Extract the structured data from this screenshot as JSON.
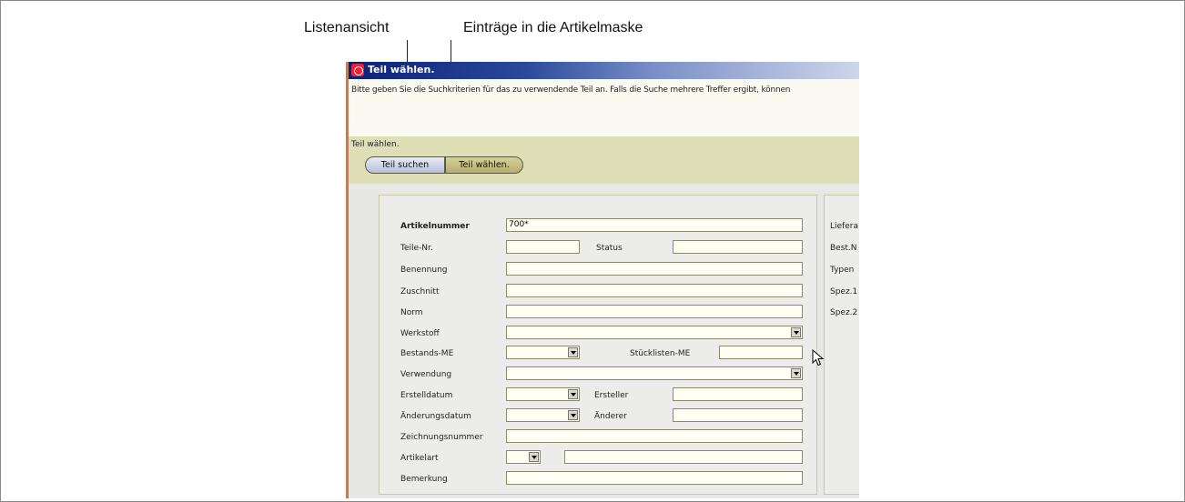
{
  "callouts": {
    "list_view": "Listenansicht",
    "entries": "Einträge in die Artikelmaske"
  },
  "window": {
    "title": "Teil wählen.",
    "description": "Bitte geben Sie die Suchkriterien für das zu verwendende Teil an. Falls die Suche mehrere Treffer ergibt, können",
    "section_label": "Teil wählen.",
    "buttons": {
      "search": "Teil suchen",
      "select": "Teil wählen."
    }
  },
  "form": {
    "artikelnummer_label": "Artikelnummer",
    "artikelnummer_value": "700*",
    "teilenr_label": "Teile-Nr.",
    "status_label": "Status",
    "benennung_label": "Benennung",
    "zuschnitt_label": "Zuschnitt",
    "norm_label": "Norm",
    "werkstoff_label": "Werkstoff",
    "bestands_me_label": "Bestands-ME",
    "stuecklisten_me_label": "Stücklisten-ME",
    "verwendung_label": "Verwendung",
    "erstelldatum_label": "Erstelldatum",
    "ersteller_label": "Ersteller",
    "aenderungsdatum_label": "Änderungsdatum",
    "aenderer_label": "Änderer",
    "zeichnungsnummer_label": "Zeichnungsnummer",
    "artikelart_label": "Artikelart",
    "bemerkung_label": "Bemerkung"
  },
  "right_panel": {
    "labels": [
      "Liefera",
      "Best.N",
      "Typen",
      "Spez.1",
      "Spez.2"
    ]
  }
}
